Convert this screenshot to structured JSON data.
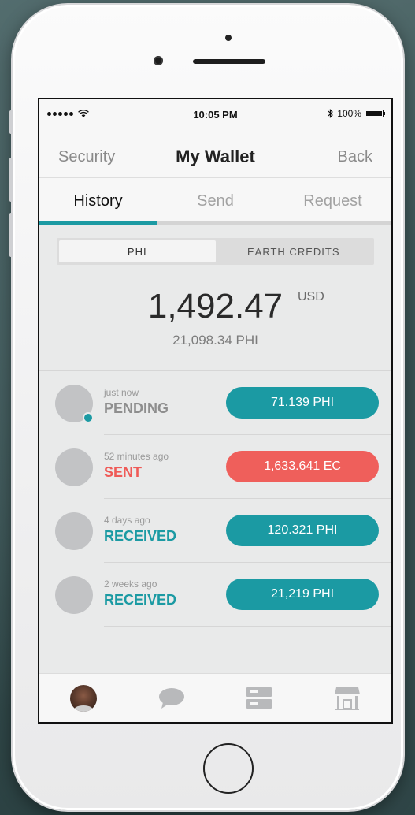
{
  "status_bar": {
    "time": "10:05 PM",
    "battery": "100%",
    "bluetooth_icon": "bluetooth-icon",
    "wifi_icon": "wifi-icon"
  },
  "nav": {
    "left": "Security",
    "title": "My Wallet",
    "right": "Back"
  },
  "tabs": [
    {
      "label": "History",
      "active": true
    },
    {
      "label": "Send",
      "active": false
    },
    {
      "label": "Request",
      "active": false
    }
  ],
  "currency_toggle": [
    {
      "label": "PHI",
      "active": true
    },
    {
      "label": "EARTH CREDITS",
      "active": false
    }
  ],
  "balance": {
    "amount": "1,492.47",
    "currency": "USD",
    "secondary": "21,098.34 PHI"
  },
  "transactions": [
    {
      "time": "just now",
      "status": "PENDING",
      "amount": "71.139 PHI",
      "status_color": "#8e8e8e",
      "pill_color": "#1b9aa3",
      "pending": true
    },
    {
      "time": "52 minutes ago",
      "status": "SENT",
      "amount": "1,633.641 EC",
      "status_color": "#ef5a57",
      "pill_color": "#ef5f5b",
      "pending": false
    },
    {
      "time": "4 days ago",
      "status": "RECEIVED",
      "amount": "120.321 PHI",
      "status_color": "#1b9aa3",
      "pill_color": "#1b9aa3",
      "pending": false
    },
    {
      "time": "2 weeks ago",
      "status": "RECEIVED",
      "amount": "21,219 PHI",
      "status_color": "#1b9aa3",
      "pill_color": "#1b9aa3",
      "pending": false
    }
  ],
  "tab_bar": [
    {
      "icon": "profile-avatar"
    },
    {
      "icon": "chat-bubble-icon"
    },
    {
      "icon": "server-list-icon"
    },
    {
      "icon": "storefront-icon"
    }
  ],
  "colors": {
    "accent": "#1b9aa3",
    "sent": "#ef5f5b"
  }
}
